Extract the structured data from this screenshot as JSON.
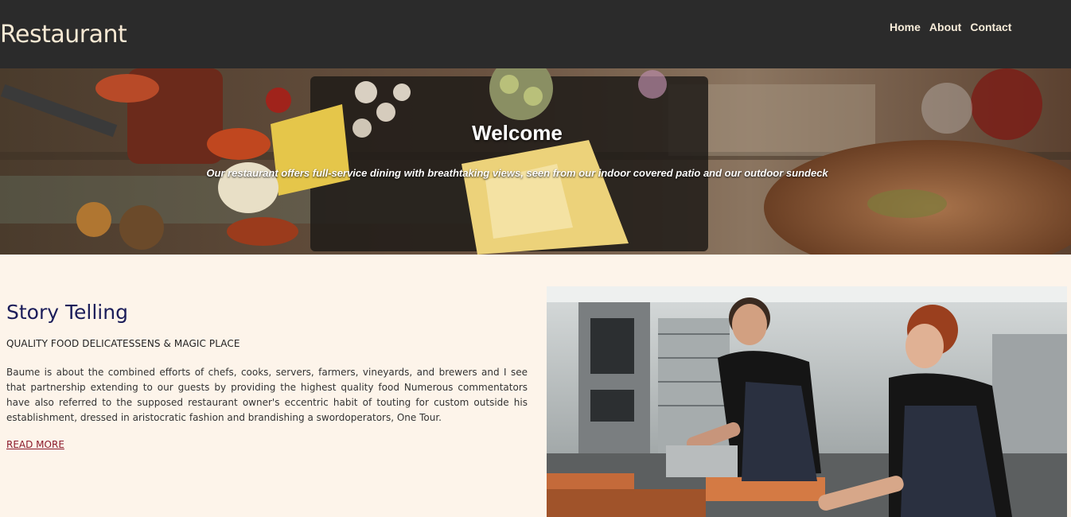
{
  "header": {
    "brand": "Restaurant",
    "nav": [
      {
        "label": "Home"
      },
      {
        "label": "About"
      },
      {
        "label": "Contact"
      }
    ]
  },
  "hero": {
    "title": "Welcome",
    "subtitle": "Our restaurant offers full-service dining with breathtaking views, seen from our indoor covered patio and our outdoor sundeck"
  },
  "story": {
    "title": "Story Telling",
    "tagline": "QUALITY FOOD DELICATESSENS & MAGIC PLACE",
    "body": "Baume is about the combined efforts of chefs, cooks, servers, farmers, vineyards, and brewers and I see that partnership extending to our guests by providing the highest quality food Numerous commentators have also referred to the supposed restaurant owner's eccentric habit of touting for custom outside his establishment, dressed in aristocratic fashion and brandishing a swordoperators, One Tour.",
    "read_more": "READ MORE"
  },
  "colors": {
    "header_bg": "#2b2b2b",
    "page_bg": "#fdf4ea",
    "title_navy": "#1b1d5a",
    "link_red": "#8b1a2b"
  }
}
